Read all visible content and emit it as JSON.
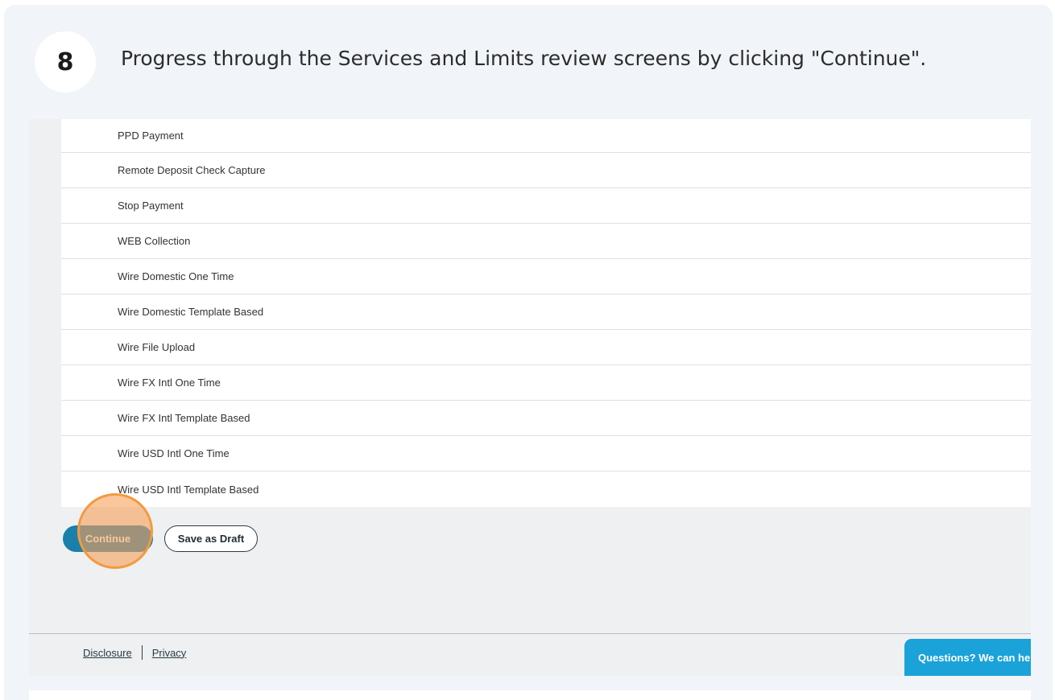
{
  "step": {
    "number": "8",
    "instruction": "Progress through the Services and Limits review screens by clicking \"Continue\"."
  },
  "services": [
    "PPD Payment",
    "Remote Deposit Check Capture",
    "Stop Payment",
    "WEB Collection",
    "Wire Domestic One Time",
    "Wire Domestic Template Based",
    "Wire File Upload",
    "Wire FX Intl One Time",
    "Wire FX Intl Template Based",
    "Wire USD Intl One Time",
    "Wire USD Intl Template Based"
  ],
  "actions": {
    "continue_label": "Continue",
    "save_draft_label": "Save as Draft"
  },
  "footer": {
    "disclosure_label": "Disclosure",
    "privacy_label": "Privacy"
  },
  "chat": {
    "label": "Questions? We can he"
  },
  "colors": {
    "primary": "#1b7fab",
    "highlight": "#f39a3f",
    "chat": "#1ba2d8"
  }
}
